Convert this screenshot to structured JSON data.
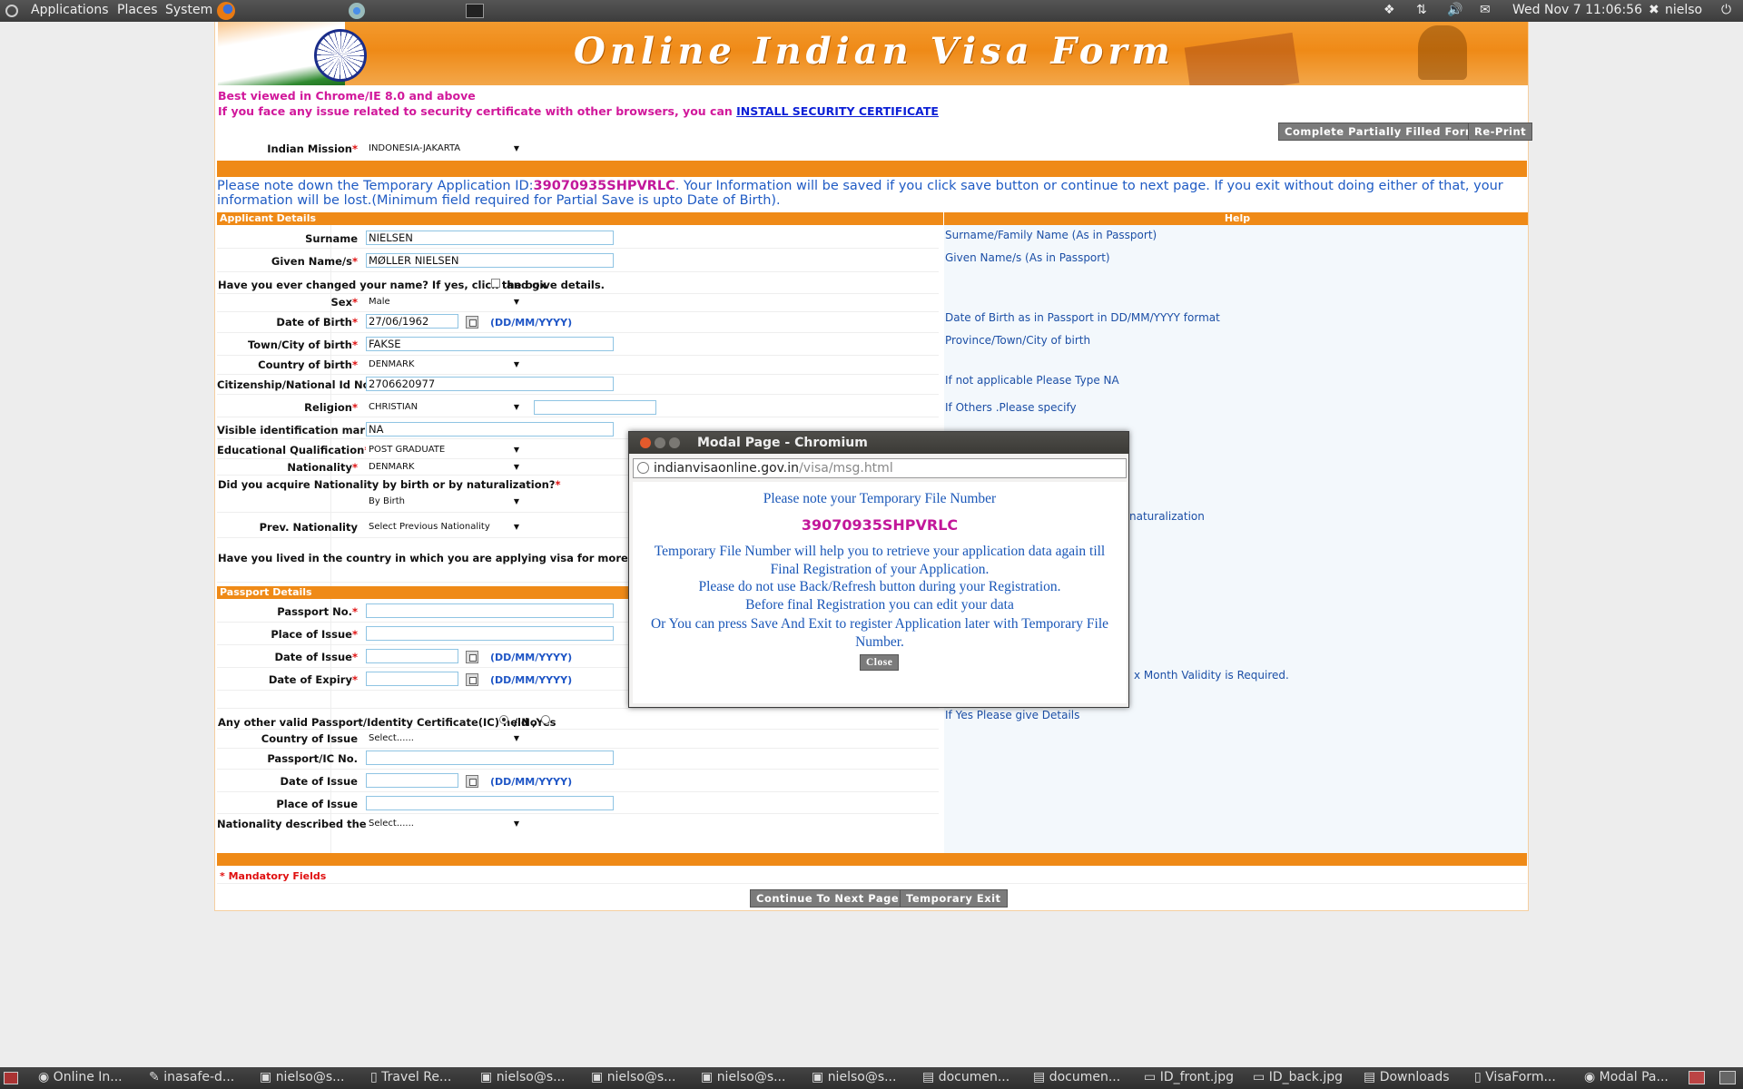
{
  "topbar": {
    "menus": [
      "Applications",
      "Places",
      "System"
    ],
    "clock": "Wed Nov 7 11:06:56",
    "user": "nielso"
  },
  "banner": {
    "title": "Online Indian Visa Form"
  },
  "notices": {
    "best_viewed": "Best viewed in Chrome/IE 8.0 and above",
    "security_prefix": "If you face any issue related to security certificate with other browsers, you can ",
    "security_link": "INSTALL SECURITY CERTIFICATE"
  },
  "buttons": {
    "complete_partial": "Complete Partially Filled Form",
    "reprint": "Re-Print",
    "continue": "Continue To Next Page",
    "temp_exit": "Temporary Exit"
  },
  "mission": {
    "label": "Indian Mission",
    "value": "INDONESIA-JAKARTA"
  },
  "temp_note": {
    "prefix": "Please note down the Temporary Application ID:",
    "id": "39070935SHPVRLC",
    "suffix": ". Your Information will be saved if you click save button or continue to next page. If you exit without doing either of that, your information will be lost.(Minimum field required for Partial Save is upto Date of Birth)."
  },
  "sections": {
    "applicant": "Applicant Details",
    "help": "Help",
    "passport": "Passport Details"
  },
  "applicant": {
    "surname": {
      "label": "Surname",
      "value": "NIELSEN",
      "help": "Surname/Family Name (As in Passport)"
    },
    "given": {
      "label": "Given Name/s",
      "value": "MØLLER NIELSEN",
      "help": "Given Name/s (As in Passport)"
    },
    "changed_name": {
      "text1": "Have you ever changed your name? If yes, click the box",
      "text2": "and give details."
    },
    "sex": {
      "label": "Sex",
      "value": "Male"
    },
    "dob": {
      "label": "Date of Birth",
      "value": "27/06/1962",
      "format": "(DD/MM/YYYY)",
      "help": "Date of Birth as in Passport in DD/MM/YYYY format"
    },
    "town": {
      "label": "Town/City of birth",
      "value": "FAKSE",
      "help": "Province/Town/City of birth"
    },
    "country": {
      "label": "Country of birth",
      "value": "DENMARK"
    },
    "citizen_id": {
      "label": "Citizenship/National Id No.",
      "value": "2706620977",
      "help": "If not applicable Please Type NA"
    },
    "religion": {
      "label": "Religion",
      "value": "CHRISTIAN",
      "help": "If Others .Please specify"
    },
    "marks": {
      "label": "Visible identification marks",
      "value": "NA"
    },
    "education": {
      "label": "Educational Qualification",
      "value": "POST GRADUATE"
    },
    "nationality": {
      "label": "Nationality",
      "value": "DENMARK"
    },
    "acquire": {
      "label": "Did you acquire Nationality by birth or by naturalization?",
      "value": "By Birth",
      "help_fragment": "naturalization"
    },
    "prev_nat": {
      "label": "Prev. Nationality",
      "value": "Select Previous Nationality"
    },
    "lived": {
      "label": "Have you lived in the country in which you are applying visa for more than two years?"
    }
  },
  "passport": {
    "no": {
      "label": "Passport No."
    },
    "place": {
      "label": "Place of Issue"
    },
    "issue": {
      "label": "Date of Issue",
      "format": "(DD/MM/YYYY)"
    },
    "expiry": {
      "label": "Date of Expiry",
      "format": "(DD/MM/YYYY)",
      "help_fragment": "x Month Validity is Required."
    },
    "other": {
      "label": "Any other valid Passport/Identity Certificate(IC) held ,Yes",
      "no": "/ No",
      "help": "If Yes Please give Details"
    },
    "other_country": {
      "label": "Country of Issue",
      "value": "Select......"
    },
    "ic_no": {
      "label": "Passport/IC No."
    },
    "other_issue": {
      "label": "Date of Issue",
      "format": "(DD/MM/YYYY)"
    },
    "other_place": {
      "label": "Place of Issue"
    },
    "nat_desc": {
      "label": "Nationality described therein",
      "value": "Select......"
    }
  },
  "mandatory": "* Mandatory Fields",
  "modal": {
    "window_title": "Modal Page - Chromium",
    "url_host": "indianvisaonline.gov.in",
    "url_path": "/visa/msg.html",
    "line1": "Please note your Temporary File Number",
    "file_no": "39070935SHPVRLC",
    "line2": "Temporary File Number will help you to retrieve your application data again till Final Registration of your Application.",
    "line3": "Please do not use Back/Refresh button during your Registration.",
    "line4": "Before final Registration you can edit your data",
    "line5": "Or You can press Save And Exit to register Application later with Temporary File Number.",
    "close": "Close"
  },
  "taskbar": [
    "Online In...",
    "inasafe-d...",
    "nielso@s...",
    "Travel Re...",
    "nielso@s...",
    "nielso@s...",
    "nielso@s...",
    "nielso@s...",
    "documen...",
    "documen...",
    "ID_front.jpg",
    "ID_back.jpg",
    "Downloads",
    "VisaForm...",
    "Modal Pa..."
  ]
}
